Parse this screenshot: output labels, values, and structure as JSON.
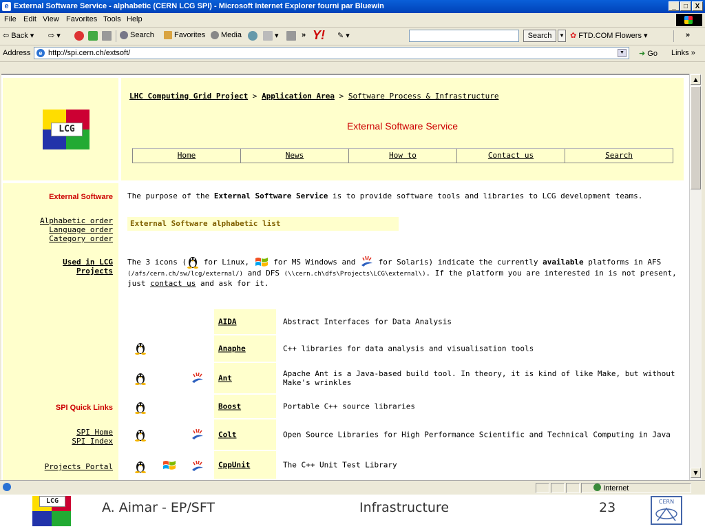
{
  "window": {
    "title": "External Software Service - alphabetic (CERN LCG SPI) - Microsoft Internet Explorer fourni par Bluewin",
    "minimize": "_",
    "maximize": "□",
    "close": "X"
  },
  "menu": [
    "File",
    "Edit",
    "View",
    "Favorites",
    "Tools",
    "Help"
  ],
  "toolbar": {
    "back": "Back",
    "search": "Search",
    "favorites": "Favorites",
    "media": "Media",
    "overflow": "»",
    "yahoo": "Y!",
    "search_button": "Search",
    "flowers": "FTD.COM Flowers",
    "more": "»"
  },
  "address": {
    "label": "Address",
    "url": "http://spi.cern.ch/extsoft/",
    "go": "Go",
    "links": "Links »"
  },
  "page": {
    "breadcrumb": {
      "item1": "LHC Computing Grid Project",
      "sep1": " > ",
      "item2": "Application Area",
      "sep2": " > ",
      "item3": "Software Process & Infrastructure"
    },
    "title": "External Software Service",
    "nav": [
      "Home",
      "News",
      "How to",
      "Contact us",
      "Search"
    ],
    "sidebar": {
      "heading1": "External Software",
      "alpha": "Alphabetic order",
      "lang": "Language order",
      "cat": "Category order",
      "used1": "Used in LCG",
      "used2": "Projects",
      "heading2": "SPI Quick Links",
      "spi_home": "SPI Home",
      "spi_index": "SPI Index",
      "portal": "Projects Portal"
    },
    "intro": {
      "before": "The purpose of the ",
      "bold": "External Software Service",
      "after": " is to provide software tools and libraries to LCG development teams."
    },
    "list_title": "External Software alphabetic list",
    "icons_para": {
      "p1": "The 3 icons (",
      "p2": " for Linux, ",
      "p3": " for MS Windows and ",
      "p4": " for Solaris) indicate the currently ",
      "bold": "available",
      "p5": " platforms in AFS",
      "afs": "(/afs/cern.ch/sw/lcg/external/)",
      "p6": " and DFS ",
      "dfs": "(\\\\cern.ch\\dfs\\Projects\\LCG\\external\\)",
      "p7": ". If the platform you are interested in is not present, just ",
      "contact": "contact us",
      "p8": " and ask for it."
    },
    "packages": [
      {
        "name": "AIDA",
        "desc": "Abstract Interfaces for Data Analysis"
      },
      {
        "name": "Anaphe",
        "desc": "C++ libraries for data analysis and visualisation tools"
      },
      {
        "name": "Ant",
        "desc": "Apache Ant is a Java-based build tool. In theory, it is kind of like Make, but without Make's wrinkles"
      },
      {
        "name": "Boost",
        "desc": "Portable C++ source libraries"
      },
      {
        "name": "Colt",
        "desc": "Open Source Libraries for High Performance Scientific and Technical Computing in Java"
      },
      {
        "name": "CppUnit",
        "desc": "The C++ Unit Test Library"
      }
    ]
  },
  "status": {
    "zone": "Internet"
  },
  "footer": {
    "author": "A. Aimar - EP/SFT",
    "topic": "Infrastructure",
    "page": "23",
    "cern": "CERN"
  },
  "colors": {
    "header_bg": "#ffffcc",
    "accent_red": "#cc0000",
    "list_title": "#806000"
  }
}
